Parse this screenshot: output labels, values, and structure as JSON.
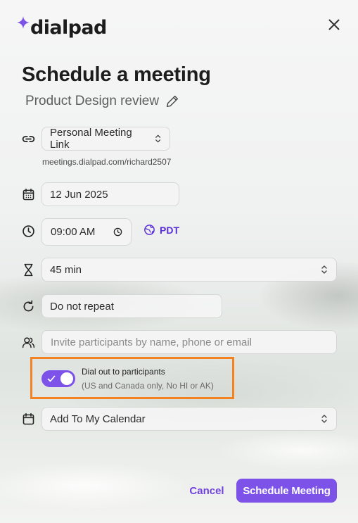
{
  "brand": {
    "logo_text": "dialpad",
    "accent": "#7c52e8",
    "spark_color": "#7c52e8"
  },
  "header": {
    "title": "Schedule a meeting",
    "meeting_name": "Product Design review",
    "close_icon": "close-icon"
  },
  "form": {
    "link_type": "Personal Meeting Link",
    "meeting_url": "meetings.dialpad.com/richard2507",
    "date": "12 Jun 2025",
    "time": "09:00 AM",
    "timezone": "PDT",
    "duration": "45 min",
    "repeat": "Do not repeat",
    "invite_placeholder": "Invite participants by name, phone or email",
    "invite_value": "",
    "dial_out": {
      "enabled": true,
      "label": "Dial out to participants",
      "note": "(US and Canada only, No HI or AK)"
    },
    "calendar": "Add To My Calendar"
  },
  "actions": {
    "cancel": "Cancel",
    "schedule": "Schedule Meeting"
  },
  "colors": {
    "highlight_border": "#f58220",
    "link_purple": "#5a2fd6"
  }
}
